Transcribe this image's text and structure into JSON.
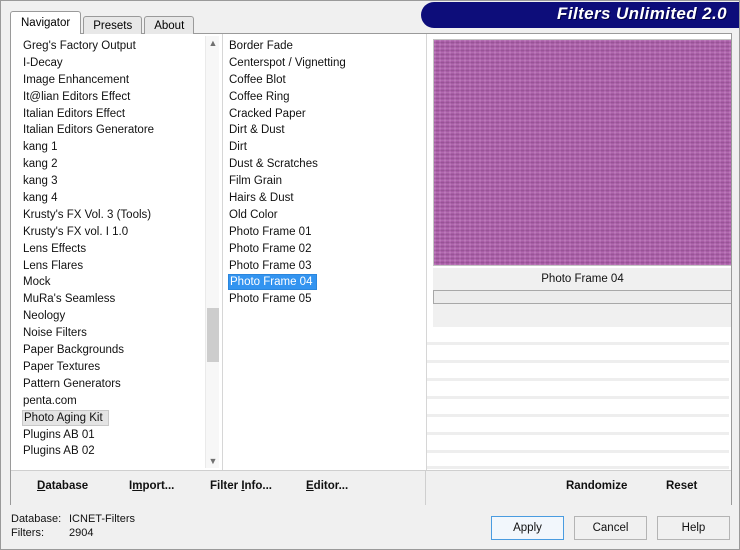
{
  "window": {
    "banner_title": "Filters Unlimited 2.0",
    "banner_color": "#0d0d7a"
  },
  "tabs": [
    {
      "label": "Navigator",
      "active": true
    },
    {
      "label": "Presets",
      "active": false
    },
    {
      "label": "About",
      "active": false
    }
  ],
  "categories": {
    "selected": "Photo Aging Kit",
    "items": [
      "Greg's Factory Output",
      "I-Decay",
      "Image Enhancement",
      "It@lian Editors Effect",
      "Italian Editors Effect",
      "Italian Editors Generatore",
      "kang 1",
      "kang 2",
      "kang 3",
      "kang 4",
      "Krusty's FX Vol. 3 (Tools)",
      "Krusty's FX vol. I 1.0",
      "Lens Effects",
      "Lens Flares",
      "Mock",
      "MuRa's Seamless",
      "Neology",
      "Noise Filters",
      "Paper Backgrounds",
      "Paper Textures",
      "Pattern Generators",
      "penta.com",
      "Photo Aging Kit",
      "Plugins AB 01",
      "Plugins AB 02"
    ]
  },
  "filters": {
    "selected": "Photo Frame 04",
    "items": [
      "Border Fade",
      "Centerspot / Vignetting",
      "Coffee Blot",
      "Coffee Ring",
      "Cracked Paper",
      "Dirt & Dust",
      "Dirt",
      "Dust & Scratches",
      "Film Grain",
      "Hairs & Dust",
      "Old Color",
      "Photo Frame 01",
      "Photo Frame 02",
      "Photo Frame 03",
      "Photo Frame 04",
      "Photo Frame 05"
    ]
  },
  "preview": {
    "caption": "Photo Frame 04",
    "swatch_color": "#b061ae"
  },
  "actions": {
    "database": {
      "pre": "",
      "accel": "D",
      "post": "atabase"
    },
    "import": {
      "pre": "I",
      "accel": "m",
      "post": "port..."
    },
    "filter_info": {
      "pre": "Filter ",
      "accel": "I",
      "post": "nfo..."
    },
    "editor": {
      "pre": "",
      "accel": "E",
      "post": "ditor..."
    },
    "randomize": "Randomize",
    "reset": "Reset"
  },
  "status": {
    "database_label": "Database:",
    "database_value": "ICNET-Filters",
    "filters_label": "Filters:",
    "filters_value": "2904"
  },
  "buttons": {
    "apply": "Apply",
    "cancel": "Cancel",
    "help": "Help"
  },
  "icons": {
    "scroll_up": "▲",
    "scroll_down": "▼"
  }
}
